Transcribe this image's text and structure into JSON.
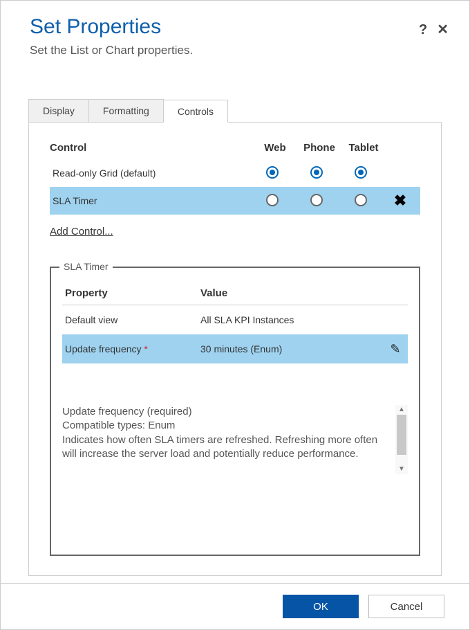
{
  "header": {
    "title": "Set Properties",
    "subtitle": "Set the List or Chart properties."
  },
  "tabs": {
    "display": "Display",
    "formatting": "Formatting",
    "controls": "Controls"
  },
  "grid": {
    "col_control": "Control",
    "col_web": "Web",
    "col_phone": "Phone",
    "col_tablet": "Tablet",
    "row1": "Read-only Grid (default)",
    "row2": "SLA Timer",
    "add": "Add Control..."
  },
  "props": {
    "legend": "SLA Timer",
    "col_prop": "Property",
    "col_val": "Value",
    "r1_name": "Default view",
    "r1_val": "All SLA KPI Instances",
    "r2_name": "Update frequency",
    "r2_req": " *",
    "r2_val": "30 minutes (Enum)",
    "desc_l1": "Update frequency (required)",
    "desc_l2": "Compatible types: Enum",
    "desc_l3": "Indicates how often SLA timers are refreshed. Refreshing more often will increase the server load and potentially reduce performance."
  },
  "footer": {
    "ok": "OK",
    "cancel": "Cancel"
  }
}
